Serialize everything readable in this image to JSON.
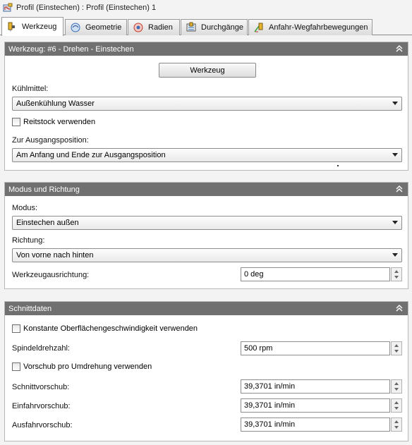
{
  "window": {
    "title": "Profil (Einstechen) : Profil (Einstechen) 1",
    "icon": "profile-op-icon"
  },
  "tabs": [
    {
      "label": "Werkzeug",
      "icon": "tool-icon",
      "active": true
    },
    {
      "label": "Geometrie",
      "icon": "geometry-icon",
      "active": false
    },
    {
      "label": "Radien",
      "icon": "radii-icon",
      "active": false
    },
    {
      "label": "Durchgänge",
      "icon": "passes-icon",
      "active": false
    },
    {
      "label": "Anfahr-Wegfahrbewegungen",
      "icon": "linking-icon",
      "active": false
    }
  ],
  "tool_panel": {
    "header": "Werkzeug: #6 - Drehen - Einstechen",
    "tool_button": "Werkzeug",
    "coolant_label": "Kühlmittel:",
    "coolant_value": "Außenkühlung Wasser",
    "tailstock_label": "Reitstock verwenden",
    "tailstock_checked": false,
    "home_label": "Zur Ausgangsposition:",
    "home_value": "Am Anfang und Ende zur Ausgangsposition"
  },
  "mode_panel": {
    "header": "Modus und Richtung",
    "mode_label": "Modus:",
    "mode_value": "Einstechen außen",
    "direction_label": "Richtung:",
    "direction_value": "Von vorne nach hinten",
    "orientation_label": "Werkzeugausrichtung:",
    "orientation_value": "0 deg"
  },
  "cut_panel": {
    "header": "Schnittdaten",
    "css_label": "Konstante Oberflächengeschwindigkeit verwenden",
    "css_checked": false,
    "spindle_label": "Spindeldrehzahl:",
    "spindle_value": "500 rpm",
    "feed_per_rev_label": "Vorschub pro Umdrehung verwenden",
    "feed_per_rev_checked": false,
    "cutting_feed_label": "Schnittvorschub:",
    "cutting_feed_value": "39,3701 in/min",
    "lead_in_feed_label": "Einfahrvorschub:",
    "lead_in_feed_value": "39,3701 in/min",
    "lead_out_feed_label": "Ausfahrvorschub:",
    "lead_out_feed_value": "39,3701 in/min"
  }
}
